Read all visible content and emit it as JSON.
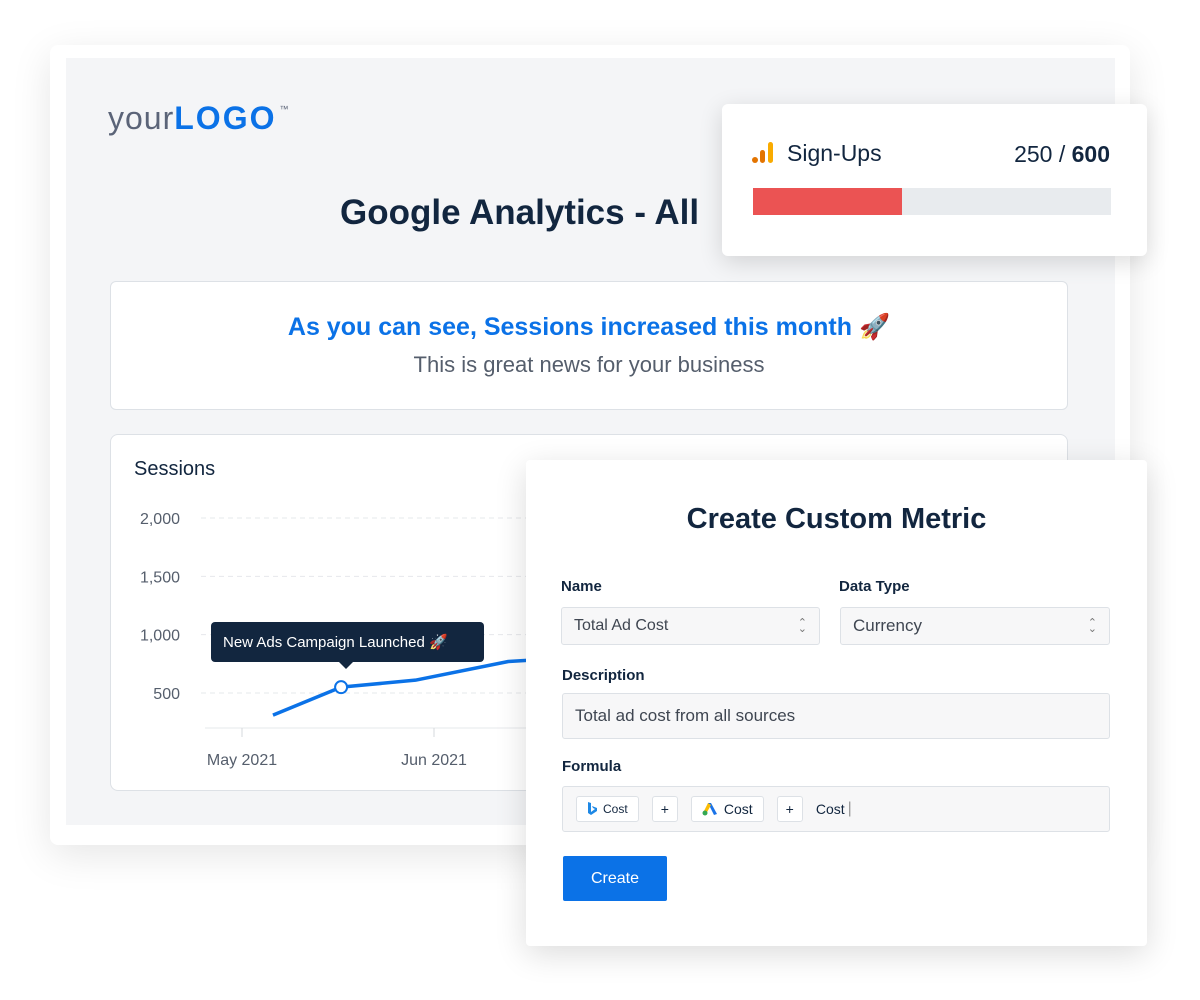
{
  "logo": {
    "part1": "your",
    "part2": "LOGO",
    "tm": "™"
  },
  "report": {
    "title": "Google Analytics - All"
  },
  "message": {
    "headline": "As you can see, Sessions increased this month 🚀",
    "subtext": "This is great news for your business"
  },
  "chart_data": {
    "type": "line",
    "title": "Sessions",
    "ylim": [
      300,
      2000
    ],
    "yticks": [
      "2,000",
      "1,500",
      "1,000",
      "500"
    ],
    "ytick_values": [
      2000,
      1500,
      1000,
      500
    ],
    "xticks": [
      "May 2021",
      "Jun 2021"
    ],
    "xtick_dates": [
      "2021-05-01",
      "2021-06-01"
    ],
    "grid": true,
    "series": [
      {
        "color": "#0b72e7",
        "x": [
          "2021-05-06",
          "2021-05-17",
          "2021-05-29",
          "2021-06-13",
          "2021-06-16",
          "2021-06-25"
        ],
        "y": [
          310,
          550,
          610,
          770,
          780,
          800
        ]
      }
    ],
    "annotation": {
      "text": "New Ads Campaign Launched 🚀",
      "x": "2021-05-17",
      "y": 550
    }
  },
  "signups": {
    "label": "Sign-Ups",
    "current": "250",
    "separator": " / ",
    "goal": "600",
    "progress": 0.417,
    "bar_color": "#eb5353"
  },
  "custom_metric": {
    "title": "Create Custom Metric",
    "name_label": "Name",
    "name_value": "Total Ad Cost",
    "type_label": "Data Type",
    "type_value": "Currency",
    "desc_label": "Description",
    "desc_value": "Total ad cost from all sources",
    "formula_label": "Formula",
    "formula": {
      "chip1": "Cost",
      "plus1": "+",
      "chip2": "Cost",
      "plus2": "+",
      "text": "Cost"
    },
    "create_label": "Create"
  }
}
